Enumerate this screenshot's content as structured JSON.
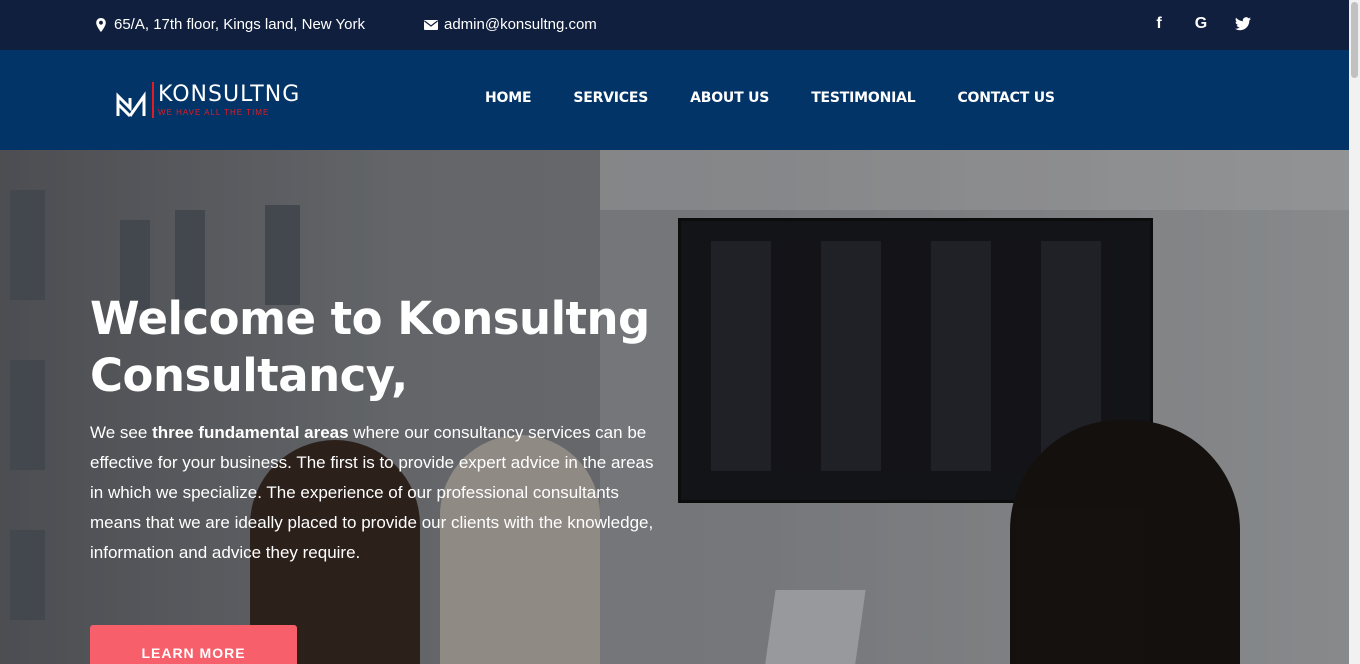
{
  "topbar": {
    "address": "65/A, 17th floor, Kings land, New York",
    "email": "admin@konsultng.com",
    "social": [
      "f",
      "G",
      "t"
    ],
    "social_icons": [
      "facebook-icon",
      "google-icon",
      "twitter-icon"
    ]
  },
  "brand": {
    "name": "KONSULTNG",
    "tagline": "WE HAVE ALL THE TIME"
  },
  "nav": {
    "items": [
      "HOME",
      "SERVICES",
      "ABOUT US",
      "TESTIMONIAL",
      "CONTACT US"
    ]
  },
  "hero": {
    "title_line1": "Welcome to Konsultng",
    "title_line2": "Consultancy,",
    "text_prefix": "We see ",
    "text_bold": "three fundamental areas",
    "text_rest": " where our consultancy services can be effective for your business. The first is to provide expert advice in the areas in which we specialize. The experience of our professional consultants means that we are ideally placed to provide our clients with the knowledge, information and advice they require.",
    "button": "LEARN MORE"
  },
  "colors": {
    "topbar_bg": "#0f1f3d",
    "nav_bg": "#033468",
    "accent_red": "#e31b23",
    "button_bg": "#f75f6a"
  }
}
